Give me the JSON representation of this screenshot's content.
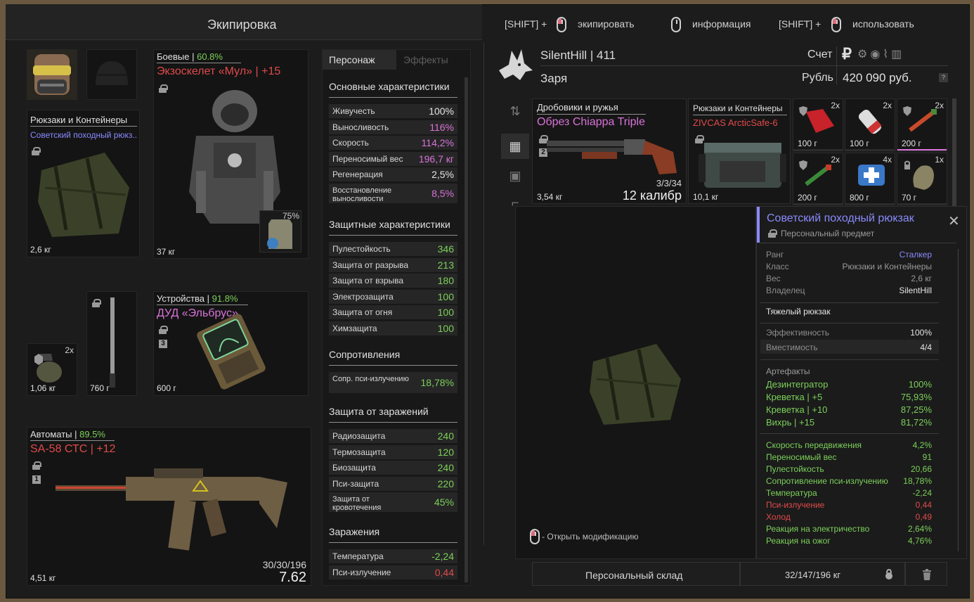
{
  "equip_title": "Экипировка",
  "controls": {
    "shift1": "[SHIFT] +",
    "equip": "экипировать",
    "info": "информация",
    "shift2": "[SHIFT] +",
    "use": "использовать"
  },
  "backpack": {
    "category": "Рюкзаки и Контейнеры",
    "name": "Советский походный рюкз..",
    "weight": "2,6 кг"
  },
  "armor": {
    "category": "Боевые",
    "percent": "60.8%",
    "name": "Экзоскелет «Мул»",
    "upgrade": "+15",
    "weight": "37 кг",
    "plate_percent": "75%"
  },
  "grenade": {
    "count": "2x",
    "weight": "1,06 кг"
  },
  "melee": {
    "weight": "760 г"
  },
  "device": {
    "category": "Устройства",
    "percent": "91.8%",
    "name": "ДУД «Эльбрус»",
    "slot_no": "3",
    "weight": "600 г"
  },
  "rifle": {
    "category": "Автоматы",
    "percent": "89.5%",
    "name": "SA-58 СТС",
    "upgrade": "+12",
    "slot_no": "1",
    "ammo": "30/30/196",
    "caliber": "7.62",
    "weight": "4,51 кг"
  },
  "tabs": {
    "character": "Персонаж",
    "effects": "Эффекты"
  },
  "stats": {
    "basic_title": "Основные характеристики",
    "basic": [
      {
        "label": "Живучесть",
        "value": "100%",
        "color": "#e4e4e4"
      },
      {
        "label": "Выносливость",
        "value": "116%",
        "color": "#d873d8"
      },
      {
        "label": "Скорость",
        "value": "114,2%",
        "color": "#d873d8"
      },
      {
        "label": "Переносимый вес",
        "value": "196,7 кг",
        "color": "#d873d8"
      },
      {
        "label": "Регенерация",
        "value": "2,5%",
        "color": "#e4e4e4"
      },
      {
        "label": "Восстановление выносливости",
        "value": "8,5%",
        "color": "#d873d8"
      }
    ],
    "protection_title": "Защитные характеристики",
    "protection": [
      {
        "label": "Пулестойкость",
        "value": "346",
        "color": "#7cd05a"
      },
      {
        "label": "Защита от разрыва",
        "value": "213",
        "color": "#7cd05a"
      },
      {
        "label": "Защита от взрыва",
        "value": "180",
        "color": "#7cd05a"
      },
      {
        "label": "Электрозащита",
        "value": "100",
        "color": "#7cd05a"
      },
      {
        "label": "Защита от огня",
        "value": "100",
        "color": "#7cd05a"
      },
      {
        "label": "Химзащита",
        "value": "100",
        "color": "#7cd05a"
      }
    ],
    "resist_title": "Сопротивления",
    "resist": [
      {
        "label": "Сопр. пси-излучению",
        "value": "18,78%",
        "color": "#7cd05a"
      }
    ],
    "contam_title": "Защита от заражений",
    "contam": [
      {
        "label": "Радиозащита",
        "value": "240",
        "color": "#7cd05a"
      },
      {
        "label": "Термозащита",
        "value": "120",
        "color": "#7cd05a"
      },
      {
        "label": "Биозащита",
        "value": "240",
        "color": "#7cd05a"
      },
      {
        "label": "Пси-защита",
        "value": "220",
        "color": "#7cd05a"
      },
      {
        "label": "Защита от кровотечения",
        "value": "45%",
        "color": "#7cd05a"
      }
    ],
    "infect_title": "Заражения",
    "infect": [
      {
        "label": "Температура",
        "value": "-2,24",
        "color": "#7cd05a"
      },
      {
        "label": "Пси-излучение",
        "value": "0,44",
        "color": "#e14a4a"
      }
    ]
  },
  "player": {
    "name": "SilentHill | 411",
    "faction": "Заря",
    "account_label": "Счет",
    "currency": "Рубль",
    "money": "420 090 руб.",
    "help": "?"
  },
  "stash": {
    "shotgun": {
      "category": "Дробовики и ружья",
      "name": "Обрез Chiappa Triple",
      "slot_no": "2",
      "ammo": "3/3/34",
      "weight": "3,54 кг",
      "caliber": "12 калибр"
    },
    "container": {
      "category": "Рюкзаки и Контейнеры",
      "name": "ZIVCAS ArcticSafe-6",
      "weight": "10,1 кг"
    },
    "items": [
      {
        "count": "2x",
        "weight": "100 г"
      },
      {
        "count": "2x",
        "weight": "100 г"
      },
      {
        "count": "2x",
        "weight": "200 г"
      },
      {
        "count": "2x",
        "weight": "200 г"
      },
      {
        "count": "4x",
        "weight": "800 г"
      },
      {
        "count": "1x",
        "weight": "70 г"
      }
    ]
  },
  "tooltip": {
    "title": "Советский походный рюкзак",
    "subtitle": "Персональный предмет",
    "rows": [
      {
        "k": "Ранг",
        "v": "Сталкер"
      },
      {
        "k": "Класс",
        "v": "Рюкзаки и Контейнеры"
      },
      {
        "k": "Вес",
        "v": "2,6 кг"
      },
      {
        "k": "Владелец",
        "v": "SilentHill"
      }
    ],
    "description": "Тяжелый рюкзак",
    "efficiency": {
      "k": "Эффективность",
      "v": "100%"
    },
    "capacity": {
      "k": "Вместимость",
      "v": "4/4"
    },
    "artifacts_title": "Артефакты",
    "artifacts": [
      {
        "k": "Дезинтегратор",
        "v": "100%"
      },
      {
        "k": "Креветка | +5",
        "v": "75,93%"
      },
      {
        "k": "Креветка | +10",
        "v": "87,25%"
      },
      {
        "k": "Вихрь | +15",
        "v": "81,72%"
      }
    ],
    "effects": [
      {
        "k": "Скорость передвижения",
        "v": "4,2%",
        "c": "#7cd05a"
      },
      {
        "k": "Переносимый вес",
        "v": "91",
        "c": "#7cd05a"
      },
      {
        "k": "Пулестойкость",
        "v": "20,66",
        "c": "#7cd05a"
      },
      {
        "k": "Сопротивление пси-излучению",
        "v": "18,78%",
        "c": "#7cd05a"
      },
      {
        "k": "Температура",
        "v": "-2,24",
        "c": "#7cd05a"
      },
      {
        "k": "Пси-излучение",
        "v": "0,44",
        "c": "#e14a4a"
      },
      {
        "k": "Холод",
        "v": "0,49",
        "c": "#e14a4a"
      },
      {
        "k": "Реакция на электричество",
        "v": "2,64%",
        "c": "#7cd05a"
      },
      {
        "k": "Реакция на ожог",
        "v": "4,76%",
        "c": "#7cd05a"
      }
    ],
    "open_mod": "- Открыть модификацию"
  },
  "bottom": {
    "storage": "Персональный склад",
    "weight": "32/147/196 кг"
  },
  "colors": {
    "green": "#7cd05a",
    "pink": "#d873d8",
    "red": "#e14a4a",
    "blue": "#8a8aff",
    "bg": "#1c1c1c"
  }
}
